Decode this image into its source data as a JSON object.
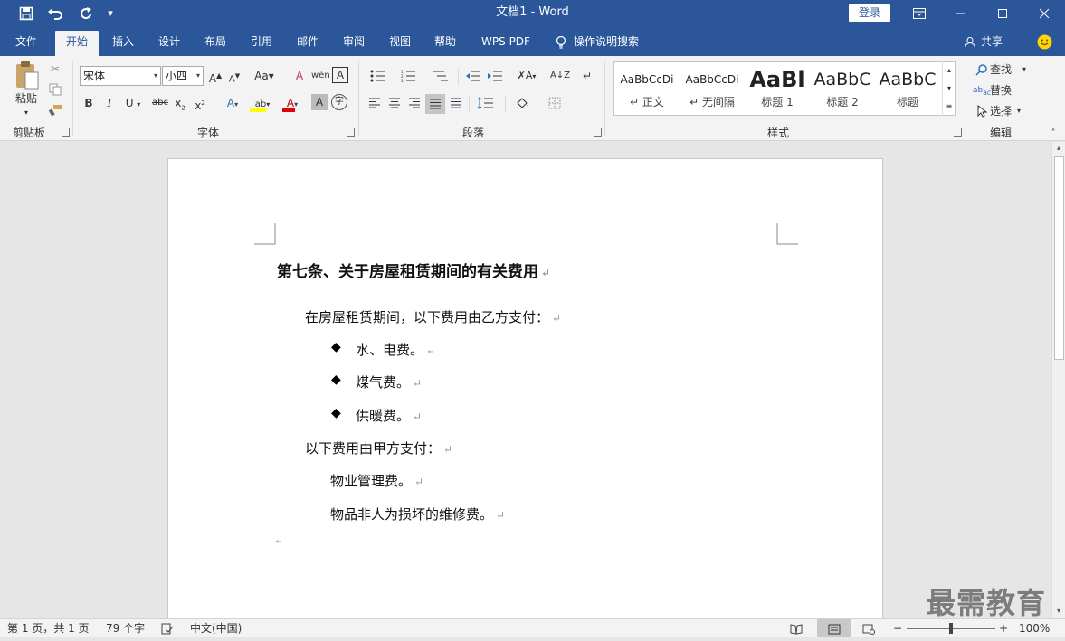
{
  "window": {
    "title": "文档1  -  Word",
    "login": "登录"
  },
  "qat": {
    "save": "save-icon",
    "undo": "undo-icon",
    "redo": "redo-icon",
    "customize": "customize-icon"
  },
  "tabs": [
    {
      "label": "文件"
    },
    {
      "label": "开始"
    },
    {
      "label": "插入"
    },
    {
      "label": "设计"
    },
    {
      "label": "布局"
    },
    {
      "label": "引用"
    },
    {
      "label": "邮件"
    },
    {
      "label": "审阅"
    },
    {
      "label": "视图"
    },
    {
      "label": "帮助"
    },
    {
      "label": "WPS PDF"
    },
    {
      "label": "操作说明搜索"
    }
  ],
  "share": "共享",
  "ribbon": {
    "clipboard": {
      "label": "剪贴板",
      "paste": "粘贴"
    },
    "font": {
      "label": "字体",
      "font_name": "宋体",
      "font_size": "小四"
    },
    "paragraph": {
      "label": "段落"
    },
    "styles": {
      "label": "样式",
      "items": [
        {
          "sample": "AaBbCcDi",
          "name": "↵ 正文"
        },
        {
          "sample": "AaBbCcDi",
          "name": "↵ 无间隔"
        },
        {
          "sample": "AaBl",
          "name": "标题 1"
        },
        {
          "sample": "AaBbC",
          "name": "标题 2"
        },
        {
          "sample": "AaBbC",
          "name": "标题"
        }
      ]
    },
    "editing": {
      "label": "编辑",
      "find": "查找",
      "replace": "替换",
      "select": "选择"
    }
  },
  "document": {
    "heading": "第七条、关于房屋租赁期间的有关费用",
    "intro": "在房屋租赁期间，以下费用由乙方支付：",
    "bullets": [
      "水、电费。",
      "煤气费。",
      "供暖费。"
    ],
    "intro2": "以下费用由甲方支付：",
    "items2": [
      "物业管理费。",
      "物品非人为损坏的维修费。"
    ],
    "paragraph_mark": "↵"
  },
  "status": {
    "page": "第 1 页，共 1 页",
    "words": "79 个字",
    "language": "中文(中国)",
    "zoom": "100%",
    "zoom_minus": "−",
    "zoom_plus": "+"
  },
  "watermark": "最需教育",
  "colors": {
    "brand": "#2b579a",
    "ribbon": "#f3f3f3"
  }
}
